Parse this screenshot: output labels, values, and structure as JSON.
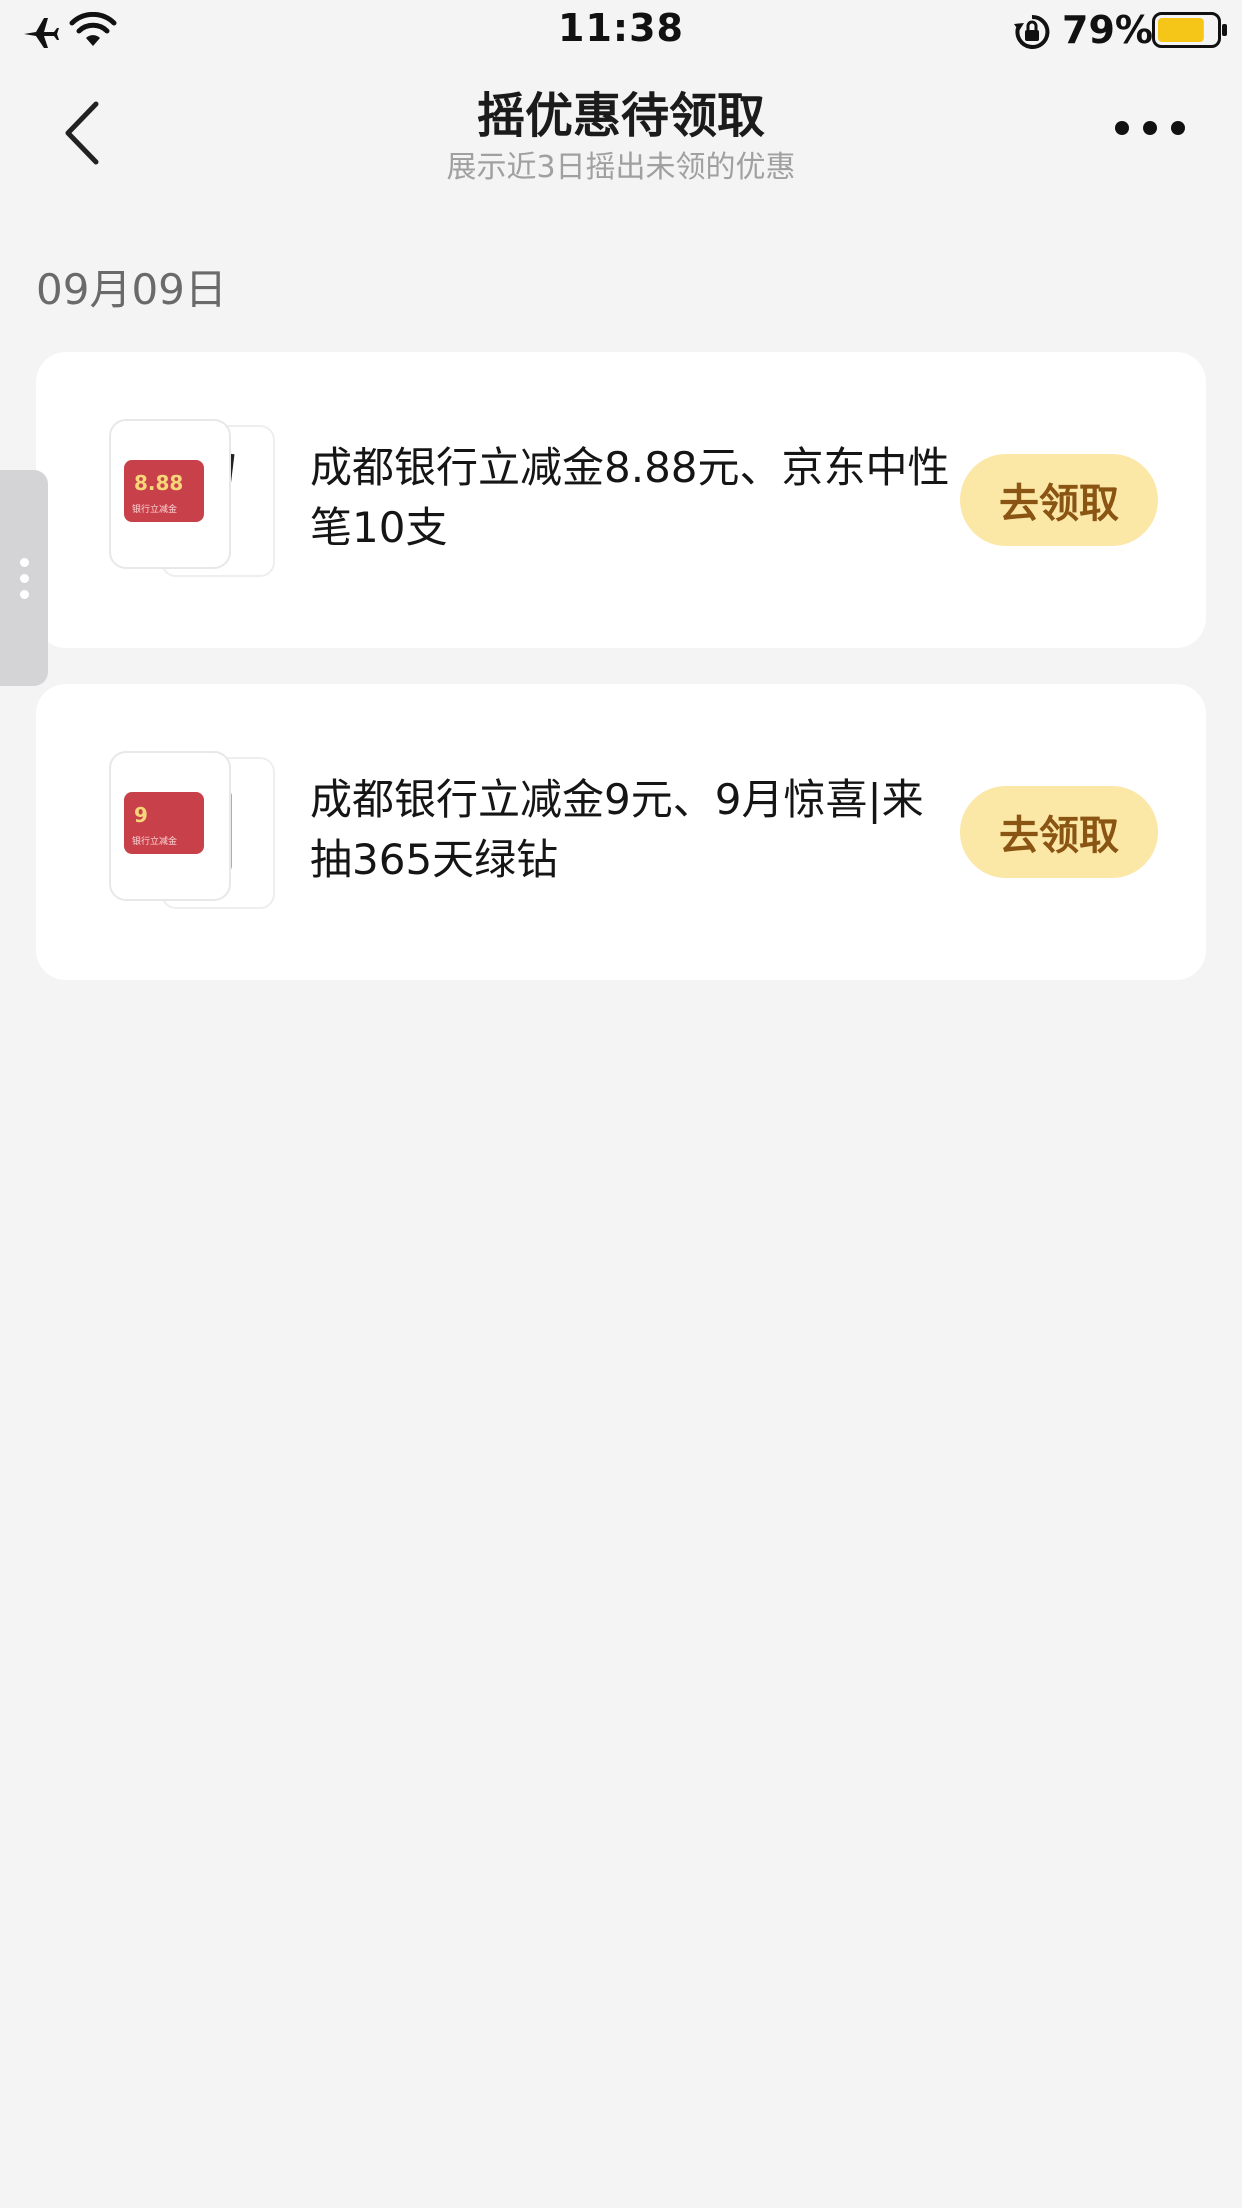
{
  "status_bar": {
    "time": "11:38",
    "battery_percent": "79%",
    "battery_level": 0.79,
    "icons": [
      "airplane-icon",
      "wifi-icon",
      "orientation-lock-icon",
      "battery-icon"
    ]
  },
  "nav": {
    "title": "摇优惠待领取",
    "subtitle": "展示近3日摇出未领的优惠",
    "icons": [
      "back-chevron-icon",
      "more-dots-icon"
    ]
  },
  "date_label": "09月09日",
  "offers": [
    {
      "description": "成都银行立减金8.88元、京东中性笔10支",
      "claim_label": "去领取",
      "thumb_amount": "8.88",
      "thumb_caption": "银行立减金"
    },
    {
      "description": "成都银行立减金9元、9月惊喜|来抽365天绿钻",
      "claim_label": "去领取",
      "thumb_amount": "9",
      "thumb_caption": "银行立减金"
    }
  ],
  "colors": {
    "background": "#f4f4f5",
    "card": "#ffffff",
    "claim_button_bg": "#fbe7a6",
    "claim_button_text": "#8a5413",
    "coupon_red": "#c8414a"
  }
}
